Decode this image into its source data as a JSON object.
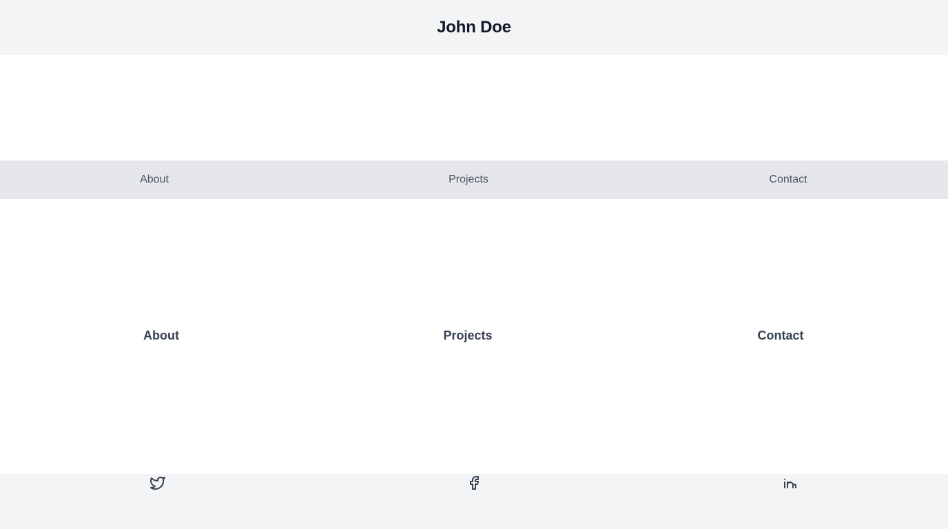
{
  "header": {
    "title": "John Doe"
  },
  "nav": {
    "items": [
      {
        "label": "About"
      },
      {
        "label": "Projects"
      },
      {
        "label": "Contact"
      }
    ]
  },
  "sections": [
    {
      "heading": "About"
    },
    {
      "heading": "Projects"
    },
    {
      "heading": "Contact"
    }
  ],
  "footer": {
    "social": [
      {
        "icon": "twitter-icon"
      },
      {
        "icon": "facebook-icon"
      },
      {
        "icon": "linkedin-icon"
      }
    ]
  },
  "colors": {
    "header_bg": "#f3f4f6",
    "nav_bg": "#e5e7eb",
    "text_dark": "#111827",
    "text_body": "#374151"
  }
}
